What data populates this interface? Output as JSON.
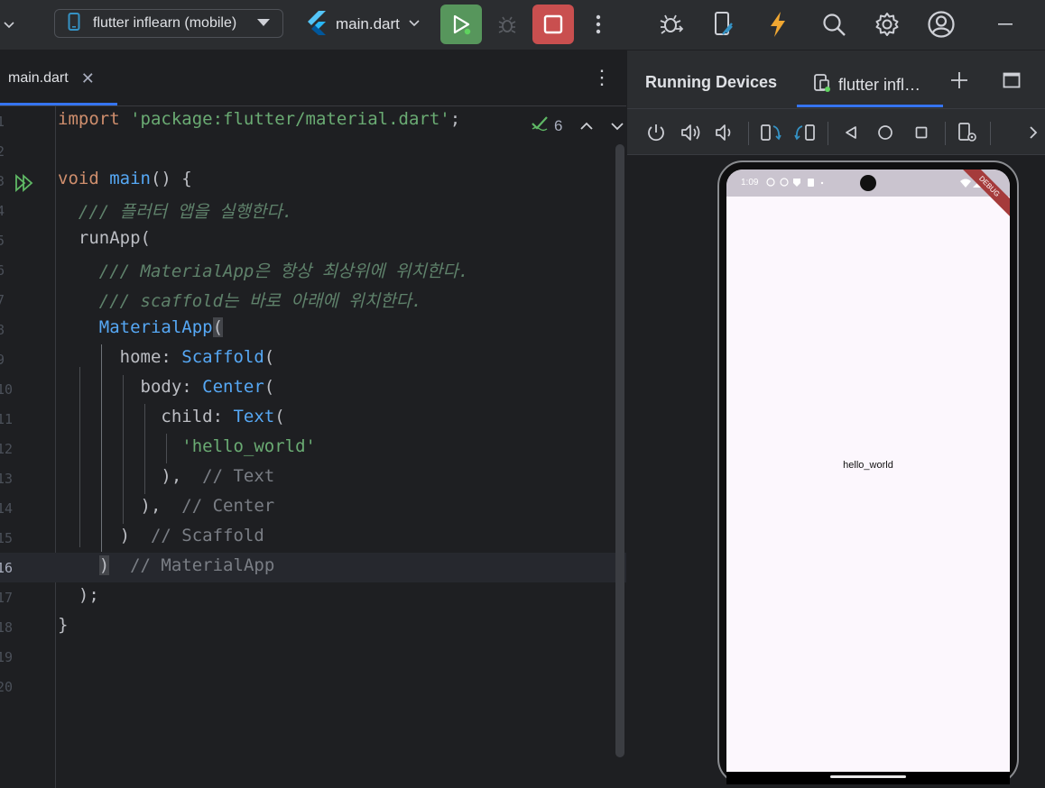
{
  "toolbar": {
    "device_selector": "flutter inflearn (mobile)",
    "run_config": "main.dart"
  },
  "editor": {
    "tab": "main.dart",
    "inspection_count": "6",
    "line_numbers": [
      "1",
      "2",
      "3",
      "4",
      "5",
      "6",
      "7",
      "8",
      "9",
      "10",
      "11",
      "12",
      "13",
      "14",
      "15",
      "16",
      "17",
      "18",
      "19",
      "20"
    ],
    "code": {
      "l1_import": "import",
      "l1_string": "'package:flutter/material.dart'",
      "l1_semi": ";",
      "l3_void": "void",
      "l3_main": "main",
      "l3_rest": "() {",
      "l4_doc": "/// 플러터 앱을 실행한다.",
      "l5_runapp": "runApp(",
      "l6_doc": "/// MaterialApp은 항상 최상위에 위치한다.",
      "l7_doc": "/// scaffold는 바로 아래에 위치한다.",
      "l8_materialapp": "MaterialApp",
      "l8_paren": "(",
      "l9_home": "home: ",
      "l9_scaffold": "Scaffold",
      "l9_paren": "(",
      "l10_body": "body: ",
      "l10_center": "Center",
      "l10_paren": "(",
      "l11_child": "child: ",
      "l11_text": "Text",
      "l11_paren": "(",
      "l12_string": "'hello_world'",
      "l13_close": "),",
      "l13_comment": "// Text",
      "l14_close": "),",
      "l14_comment": "// Center",
      "l15_close": ")",
      "l15_comment": "// Scaffold",
      "l16_close": ")",
      "l16_comment": "// MaterialApp",
      "l17_close": ");",
      "l18_close": "}"
    }
  },
  "running_devices": {
    "title": "Running Devices",
    "tab": "flutter infl…",
    "phone": {
      "time": "1:09",
      "debug_banner": "DEBUG",
      "text": "hello_world"
    }
  },
  "colors": {
    "run_green": "#57965c",
    "stop_red": "#c94f4f",
    "accent_blue": "#3574f0"
  }
}
